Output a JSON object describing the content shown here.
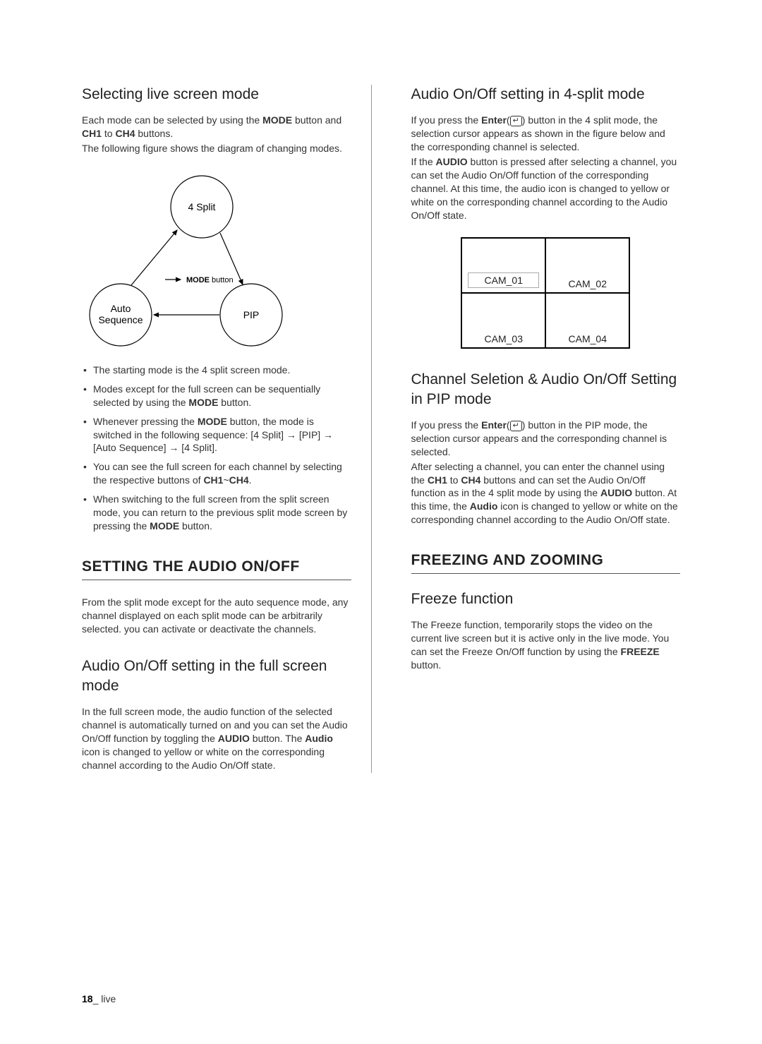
{
  "left": {
    "h_select": "Selecting live screen mode",
    "p_select_1": "Each mode can be selected by using the ",
    "p_select_1b": "MODE",
    "p_select_1c": " button and ",
    "p_select_1d": "CH1",
    "p_select_1e": " to ",
    "p_select_1f": "CH4",
    "p_select_1g": " buttons.",
    "p_select_2": "The following figure shows the diagram of changing modes.",
    "diag_top": "4 Split",
    "diag_left_1": "Auto",
    "diag_left_2": "Sequence",
    "diag_right": "PIP",
    "diag_label": "MODE",
    "diag_label_suffix": " button",
    "b1": "The starting mode is the 4 split screen mode.",
    "b2a": "Modes except for the full screen can be sequentially selected by using the ",
    "b2b": "MODE",
    "b2c": " button.",
    "b3a": "Whenever pressing the ",
    "b3b": "MODE",
    "b3c": " button, the mode is switched in the following sequence: [4 Split] → [PIP] → [Auto Sequence] → [4 Split].",
    "b4a": "You can see the full screen for each channel by selecting the respective buttons of ",
    "b4b": "CH1",
    "b4c": "~",
    "b4d": "CH4",
    "b4e": ".",
    "b5a": "When switching to the full screen from the split screen mode, you can return to the previous split mode screen by pressing the ",
    "b5b": "MODE",
    "b5c": " button.",
    "h_audio": "SETTING THE AUDIO ON/OFF",
    "p_audio": "From the split mode except for the auto sequence mode, any channel displayed on each split mode can be arbitrarily selected. you can activate or deactivate the channels.",
    "h_full": "Audio On/Off setting in the full screen mode",
    "p_full_a": "In the full screen mode, the audio function of the selected channel is automatically turned on and you can set the Audio On/Off function by toggling the ",
    "p_full_b": "AUDIO",
    "p_full_c": " button. The ",
    "p_full_d": "Audio",
    "p_full_e": " icon is changed to yellow or white on the corresponding channel according to the Audio On/Off state."
  },
  "right": {
    "h_4split": "Audio On/Off setting in 4-split mode",
    "p4a": "If you press the ",
    "p4b": "Enter",
    "p4c": "(",
    "p4d": ") button in the 4 split mode, the selection cursor appears as shown in the figure below and the corresponding channel is selected.",
    "p4e": "If the ",
    "p4f": "AUDIO",
    "p4g": " button is pressed after selecting a channel, you can set the Audio On/Off function of the corresponding channel. At this time, the audio icon is changed to yellow or white on the corresponding channel according to the Audio On/Off state.",
    "cam1": "CAM_01",
    "cam2": "CAM_02",
    "cam3": "CAM_03",
    "cam4": "CAM_04",
    "h_pip": "Channel Seletion & Audio On/Off Setting in PIP mode",
    "pp_a": "If you press the ",
    "pp_b": "Enter",
    "pp_c": "(",
    "pp_d": ") button in the PIP mode, the selection cursor appears and the corresponding channel is selected.",
    "pp_e": "After selecting a channel, you can enter the channel using the ",
    "pp_f": "CH1",
    "pp_g": " to ",
    "pp_h": "CH4",
    "pp_i": " buttons and can set the Audio On/Off function as in the 4 split mode by using the ",
    "pp_j": "AUDIO",
    "pp_k": " button. At this time, the ",
    "pp_l": "Audio",
    "pp_m": " icon is changed to yellow or white on the corresponding channel according to the Audio On/Off state.",
    "h_freeze_sec": "FREEZING AND ZOOMING",
    "h_freeze": "Freeze function",
    "pf_a": "The Freeze function, temporarily stops the video on the current live screen but it is active only in the live mode. You can set the Freeze On/Off function by using the ",
    "pf_b": "FREEZE",
    "pf_c": " button."
  },
  "footer": {
    "page": "18",
    "section": "_ live"
  },
  "enter_icon_glyph": "↵"
}
